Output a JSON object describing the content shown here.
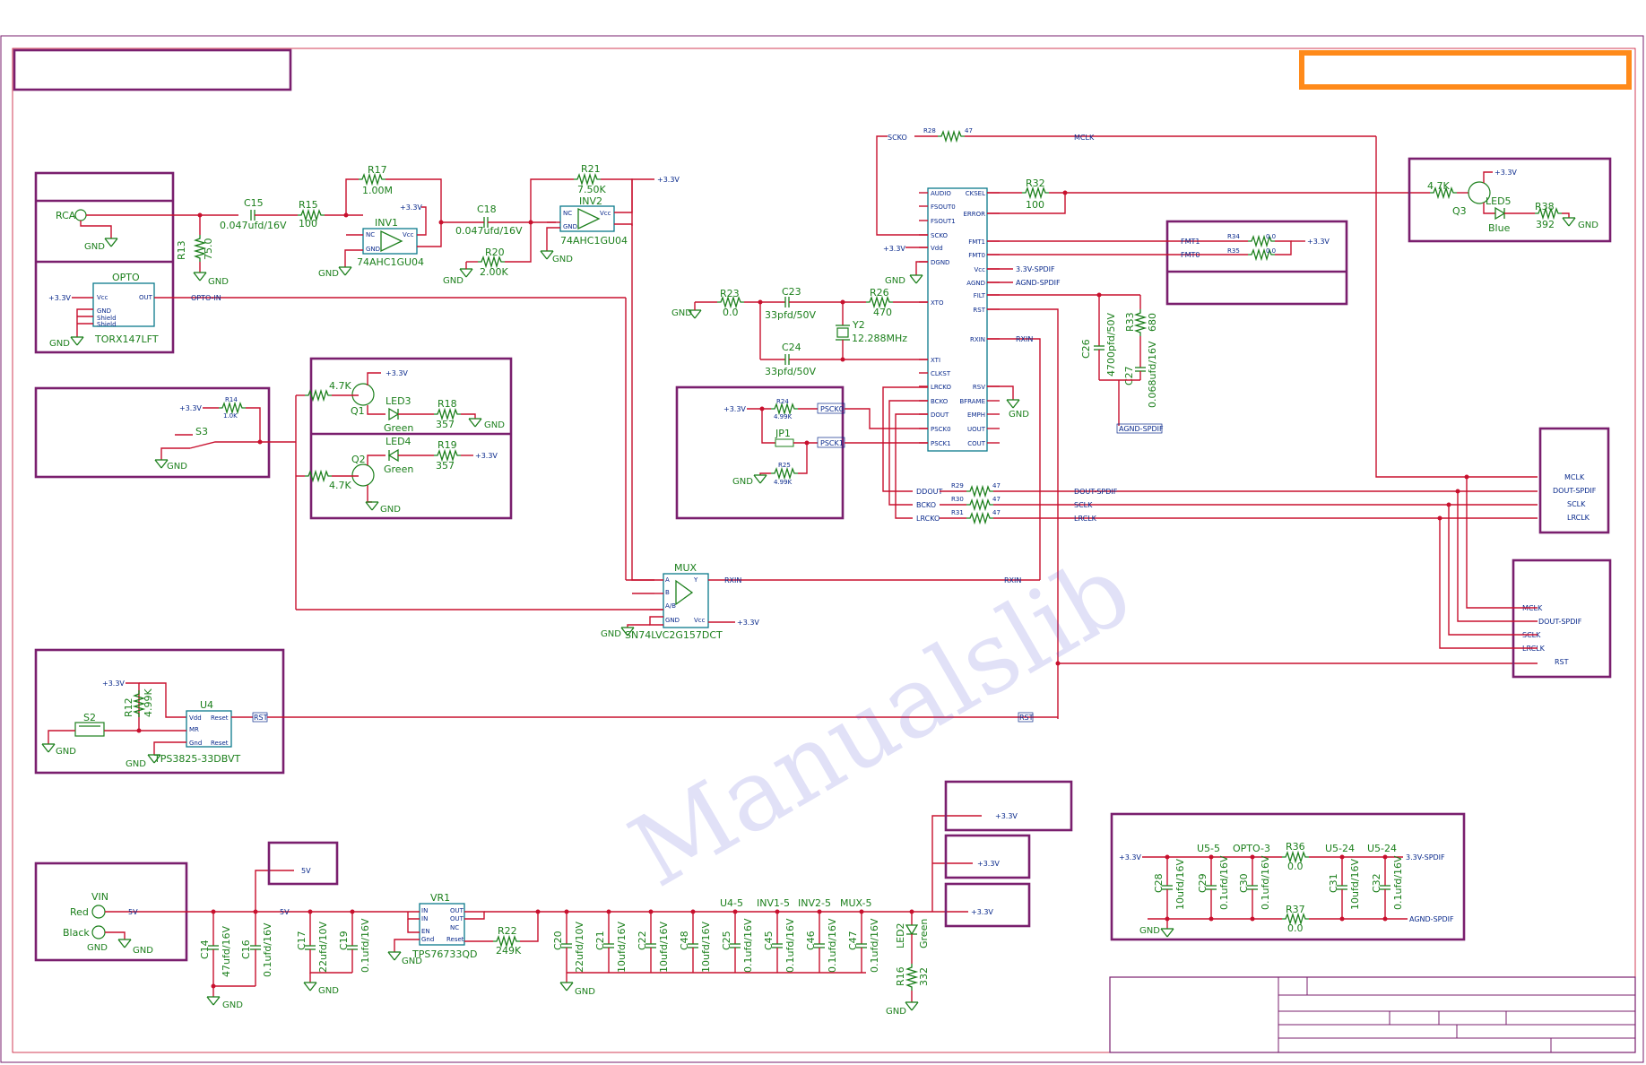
{
  "labels": {
    "gnd": "GND",
    "v33": "+3.3V",
    "v5": "5V",
    "rca": "RCA",
    "r13": "R13",
    "r13v": "75.0",
    "c15": "C15",
    "c15v": "0.047ufd/16V",
    "r15": "R15",
    "r15v": "100",
    "r17": "R17",
    "r17v": "1.00M",
    "inv1": "INV1",
    "inv1p": "74AHC1GU04",
    "c18": "C18",
    "c18v": "0.047ufd/16V",
    "r20": "R20",
    "r20v": "2.00K",
    "r21": "R21",
    "r21v": "7.50K",
    "inv2": "INV2",
    "inv2p": "74AHC1GU04",
    "opto": "OPTO",
    "optop": "TORX147LFT",
    "optoin": "OPTO-IN",
    "q1": "Q1",
    "q2": "Q2",
    "q3": "Q3",
    "k47": "4.7K",
    "led3": "LED3",
    "led4": "LED4",
    "green": "Green",
    "r18": "R18",
    "r19": "R19",
    "v357": "357",
    "r14": "R14",
    "r14v": "1.0K",
    "s3": "S3",
    "r23": "R23",
    "r23v": "0.0",
    "c23": "C23",
    "c23v": "33pfd/50V",
    "c24": "C24",
    "c24v": "33pfd/50V",
    "r26": "R26",
    "r26v": "470",
    "y2": "Y2",
    "y2v": "12.288MHz",
    "r28": "R28",
    "r28v": "47",
    "scko": "SCKO",
    "mclk": "MCLK",
    "r32": "R32",
    "r32v": "100",
    "led5": "LED5",
    "blue": "Blue",
    "r38": "R38",
    "r38v": "392",
    "r34": "R34",
    "r35": "R35",
    "r00": "0.0",
    "fmt1": "FMT1",
    "fmt0": "FMT0",
    "c26": "C26",
    "c26v": "4700pfd/50V",
    "c27": "C27",
    "c27v": "0.068ufd/16V",
    "r33": "R33",
    "r33v": "680",
    "agnd": "AGND-SPDIF",
    "v33spdif": "3.3V-SPDIF",
    "r24": "R24",
    "r25": "R25",
    "r499": "4.99K",
    "jp1": "JP1",
    "psck0": "PSCK0",
    "psck1": "PSCK1",
    "r29": "R29",
    "r30": "R30",
    "r31": "R31",
    "v47": "47",
    "ddout": "DDOUT",
    "bcko": "BCKO",
    "lrcko": "LRCKO",
    "doutspdif": "DOUT-SPDIF",
    "sclk": "SCLK",
    "lrclk": "LRCLK",
    "rst": "RST",
    "rxin": "RXIN",
    "mux": "MUX",
    "muxp": "SN74LVC2G157DCT",
    "s2": "S2",
    "r12": "R12",
    "r12v": "4.99K",
    "u4": "U4",
    "u4p": "TPS3825-33DBVT",
    "vin": "VIN",
    "red": "Red",
    "black": "Black",
    "c14": "C14",
    "c14v": "47ufd/16V",
    "c16": "C16",
    "c16v": "0.1ufd/16V",
    "c17": "C17",
    "c17v": "22ufd/10V",
    "c19": "C19",
    "c19v": "0.1ufd/16V",
    "vr1": "VR1",
    "vr1p": "TPS76733QD",
    "r22": "R22",
    "r22v": "249K",
    "c20": "C20",
    "c20v": "22ufd/10V",
    "c21": "C21",
    "c21v": "10ufd/16V",
    "c22": "C22",
    "c22v": "10ufd/16V",
    "c48": "C48",
    "c48v": "10ufd/16V",
    "c25": "C25",
    "c45": "C45",
    "c46": "C46",
    "c47": "C47",
    "v01": "0.1ufd/16V",
    "u45": "U4-5",
    "inv15": "INV1-5",
    "inv25": "INV2-5",
    "mux5": "MUX-5",
    "led2": "LED2",
    "r16": "R16",
    "r16v": "332",
    "u55": "U5-5",
    "opto3": "OPTO-3",
    "u524a": "U5-24",
    "u524b": "U5-24",
    "r36": "R36",
    "r37": "R37",
    "c28": "C28",
    "c28v": "10ufd/16V",
    "c29": "C29",
    "c30": "C30",
    "c31": "C31",
    "c31v": "10ufd/16V",
    "c32": "C32"
  },
  "u5_pins_left": [
    "AUDIO",
    "FSOUT0",
    "FSOUT1",
    "SCKO",
    "Vdd",
    "DGND",
    "XTO",
    "XTI",
    "CLKST",
    "LRCKO",
    "BCKO",
    "DOUT",
    "PSCK0",
    "PSCK1"
  ],
  "u5_pins_right": [
    "CKSEL",
    "ERROR",
    "FMT1",
    "FMT0",
    "Vcc",
    "AGND",
    "FILT",
    "RST",
    "RXIN",
    "RSV",
    "BFRAME",
    "EMPH",
    "UOUT",
    "COUT"
  ],
  "watermark": "Manualslib",
  "colors": {
    "wire": "#c8102e",
    "border": "#7a1f6e",
    "component": "#1b7f1b",
    "net": "#0a2a8c",
    "highlight": "#ff8a1a"
  }
}
